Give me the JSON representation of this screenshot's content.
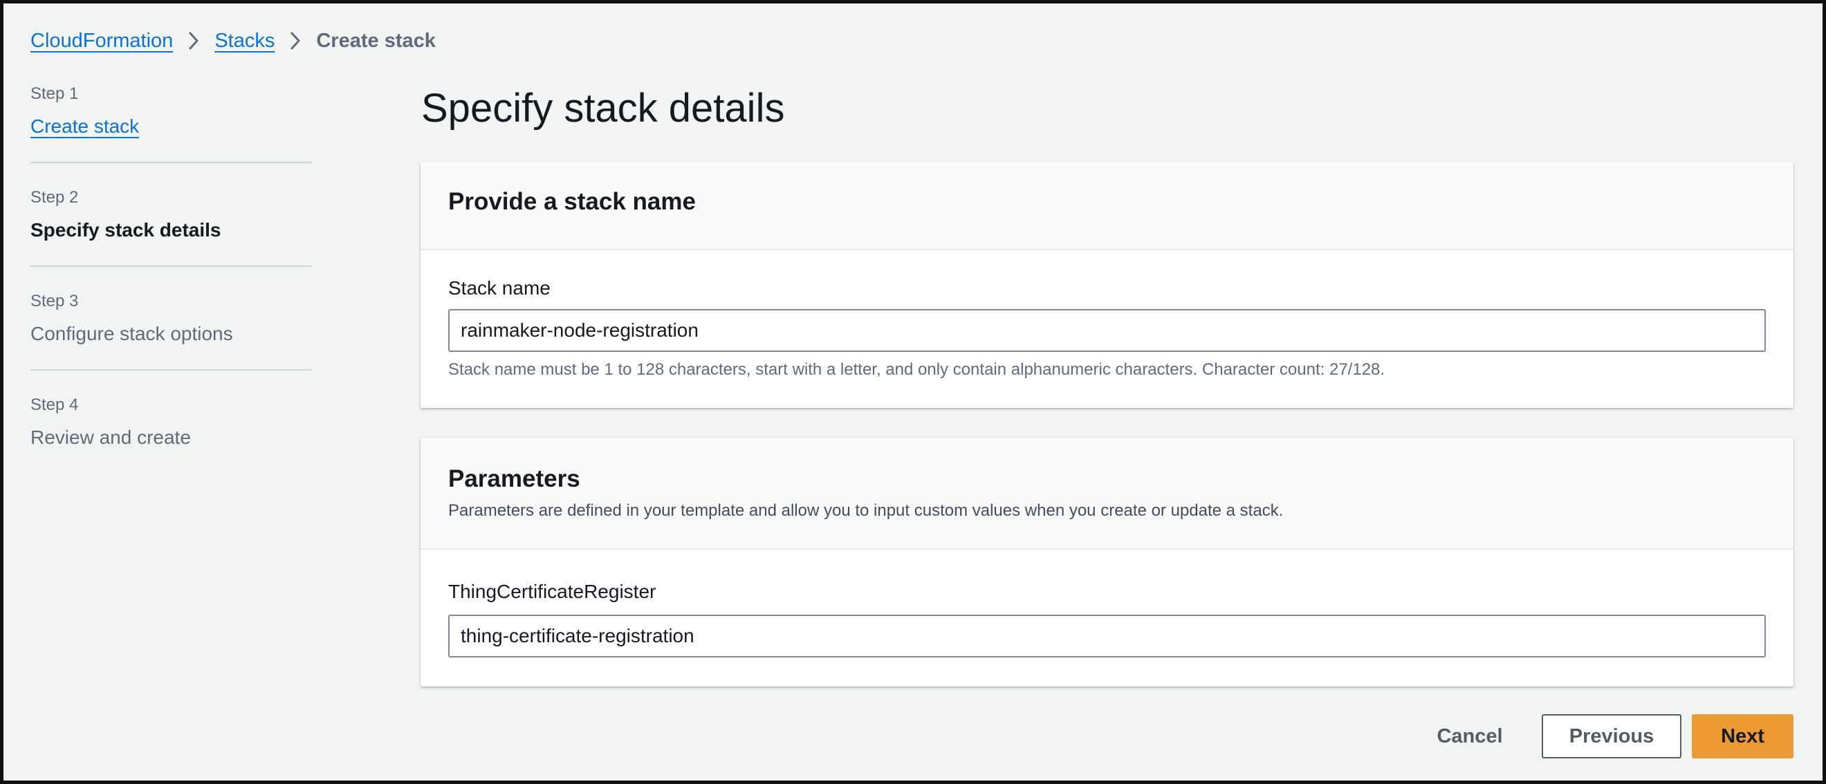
{
  "breadcrumb": {
    "items": [
      "CloudFormation",
      "Stacks"
    ],
    "current": "Create stack"
  },
  "steps": [
    {
      "number": "Step 1",
      "title": "Create stack",
      "state": "link"
    },
    {
      "number": "Step 2",
      "title": "Specify stack details",
      "state": "active"
    },
    {
      "number": "Step 3",
      "title": "Configure stack options",
      "state": "disabled"
    },
    {
      "number": "Step 4",
      "title": "Review and create",
      "state": "disabled"
    }
  ],
  "page": {
    "title": "Specify stack details"
  },
  "stack_name_panel": {
    "heading": "Provide a stack name",
    "field_label": "Stack name",
    "value": "rainmaker-node-registration",
    "help": "Stack name must be 1 to 128 characters, start with a letter, and only contain alphanumeric characters. Character count: 27/128."
  },
  "parameters_panel": {
    "heading": "Parameters",
    "description": "Parameters are defined in your template and allow you to input custom values when you create or update a stack.",
    "fields": [
      {
        "label": "ThingCertificateRegister",
        "value": "thing-certificate-registration"
      }
    ]
  },
  "actions": {
    "cancel": "Cancel",
    "previous": "Previous",
    "next": "Next"
  },
  "colors": {
    "link": "#0972d3",
    "primary_button": "#ec9a33",
    "background": "#f2f3f3"
  },
  "icons": {
    "breadcrumb_separator": "chevron-right-icon"
  }
}
